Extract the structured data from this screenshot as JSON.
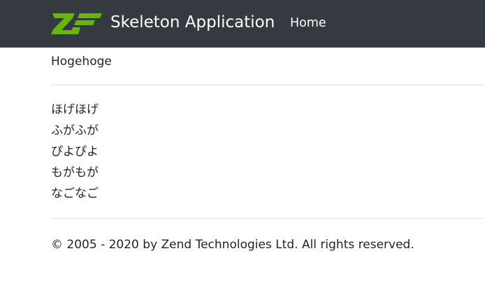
{
  "navbar": {
    "brand_text": "Skeleton Application",
    "home_label": "Home",
    "logo_icon": "zf-logo-icon",
    "background_color": "#343a40",
    "logo_color": "#68b604"
  },
  "main": {
    "heading": "Hogehoge",
    "items": [
      "ほげほげ",
      "ふがふが",
      "ぴよぴよ",
      "もがもが",
      "なごなご"
    ]
  },
  "footer": {
    "copyright": "© 2005 - 2020 by Zend Technologies Ltd. All rights reserved."
  }
}
